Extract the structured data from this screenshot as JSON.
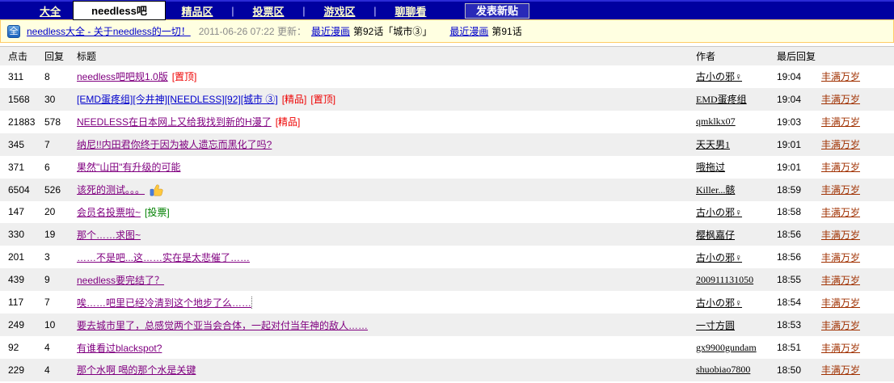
{
  "nav": {
    "tabs": [
      {
        "label": "大全"
      },
      {
        "label": "needless吧",
        "active": true
      },
      {
        "label": "精品区",
        "sep_after": true
      },
      {
        "label": "投票区",
        "sep_after": true
      },
      {
        "label": "游戏区",
        "sep_after": true
      },
      {
        "label": "聊聊看"
      }
    ],
    "post_button": "发表新贴"
  },
  "announcement": {
    "icon": "全",
    "link": "needless大全 - 关于needless的一切！",
    "updated": "2011-06-26 07:22 更新：",
    "latest1_label": "最近漫画",
    "latest1_text": "第92话「城市③」",
    "latest2_label": "最近漫画",
    "latest2_text": "第91话"
  },
  "table": {
    "headers": {
      "clicks": "点击",
      "replies": "回复",
      "title": "标题",
      "author": "作者",
      "last_reply": "最后回复"
    },
    "rows": [
      {
        "clicks": "311",
        "replies": "8",
        "title": "needless吧吧规1.0版",
        "status": "visited",
        "tags": [
          {
            "text": "[置顶]",
            "color": "tag_red"
          }
        ],
        "author": "古小の邪♀",
        "time": "19:04",
        "last_reply": "丰满万岁"
      },
      {
        "clicks": "1568",
        "replies": "30",
        "title": "[EMD蛋疼组][今井神][NEEDLESS][92][城市 ③]",
        "status": "new",
        "tags": [
          {
            "text": "[精品]",
            "color": "tag_red"
          },
          {
            "text": "[置顶]",
            "color": "tag_red"
          }
        ],
        "author": "EMD蛋疼组",
        "time": "19:04",
        "last_reply": "丰满万岁"
      },
      {
        "clicks": "21883",
        "replies": "578",
        "title": "NEEDLESS在日本网上又给我找到新的H漫了",
        "status": "visited",
        "tags": [
          {
            "text": "[精品]",
            "color": "tag_red"
          }
        ],
        "author": "qmklkx07",
        "time": "19:03",
        "last_reply": "丰满万岁"
      },
      {
        "clicks": "345",
        "replies": "7",
        "title": "纳尼!!内田君你终于因为被人遗忘而黑化了吗?",
        "status": "visited",
        "tags": [],
        "author": "天天男1",
        "time": "19:01",
        "last_reply": "丰满万岁"
      },
      {
        "clicks": "371",
        "replies": "6",
        "title": "果然\"山田\"有升级的可能",
        "status": "visited",
        "tags": [],
        "author": "哦拖过",
        "time": "19:01",
        "last_reply": "丰满万岁"
      },
      {
        "clicks": "6504",
        "replies": "526",
        "title": "该死的测试。。。",
        "status": "visited",
        "icon": "thumbs-up",
        "tags": [],
        "author": "Killer...骸",
        "time": "18:59",
        "last_reply": "丰满万岁"
      },
      {
        "clicks": "147",
        "replies": "20",
        "title": "会员名投票啦~",
        "status": "visited",
        "tags": [
          {
            "text": "[投票]",
            "color": "tag_green"
          }
        ],
        "author": "古小の邪♀",
        "time": "18:58",
        "last_reply": "丰满万岁"
      },
      {
        "clicks": "330",
        "replies": "19",
        "title": "那个……求图~",
        "status": "visited",
        "tags": [],
        "author": "樱枫嘉仔",
        "time": "18:56",
        "last_reply": "丰满万岁"
      },
      {
        "clicks": "201",
        "replies": "3",
        "title": "……不是吧...这……实在是太悲催了……",
        "status": "visited",
        "tags": [],
        "author": "古小の邪♀",
        "time": "18:56",
        "last_reply": "丰满万岁"
      },
      {
        "clicks": "439",
        "replies": "9",
        "title": "needless要完结了？",
        "status": "visited",
        "tags": [],
        "author": "200911131050",
        "time": "18:55",
        "last_reply": "丰满万岁"
      },
      {
        "clicks": "117",
        "replies": "7",
        "title": "唉……吧里已经冷清到这个地步了么……",
        "status": "visited",
        "focused": true,
        "tags": [],
        "author": "古小の邪♀",
        "time": "18:54",
        "last_reply": "丰满万岁"
      },
      {
        "clicks": "249",
        "replies": "10",
        "title": "要去城市里了，总感觉两个亚当会合体，一起对付当年神的敌人……",
        "status": "visited",
        "tags": [],
        "author": "一寸方圆",
        "time": "18:53",
        "last_reply": "丰满万岁"
      },
      {
        "clicks": "92",
        "replies": "4",
        "title": "有谁看过blackspot?",
        "status": "visited",
        "tags": [],
        "author": "gx9900gundam",
        "time": "18:51",
        "last_reply": "丰满万岁"
      },
      {
        "clicks": "229",
        "replies": "4",
        "title": "那个水啊 喝的那个水是关键",
        "status": "visited",
        "tags": [],
        "author": "shuobiao7800",
        "time": "18:50",
        "last_reply": "丰满万岁"
      }
    ]
  },
  "colors": {
    "nav_bg": "#0000A0",
    "tag_red": "#EE0000",
    "tag_green": "#008000",
    "link_blue": "#0000CC",
    "link_visited": "#800080",
    "last_reply_red": "#A03000"
  }
}
